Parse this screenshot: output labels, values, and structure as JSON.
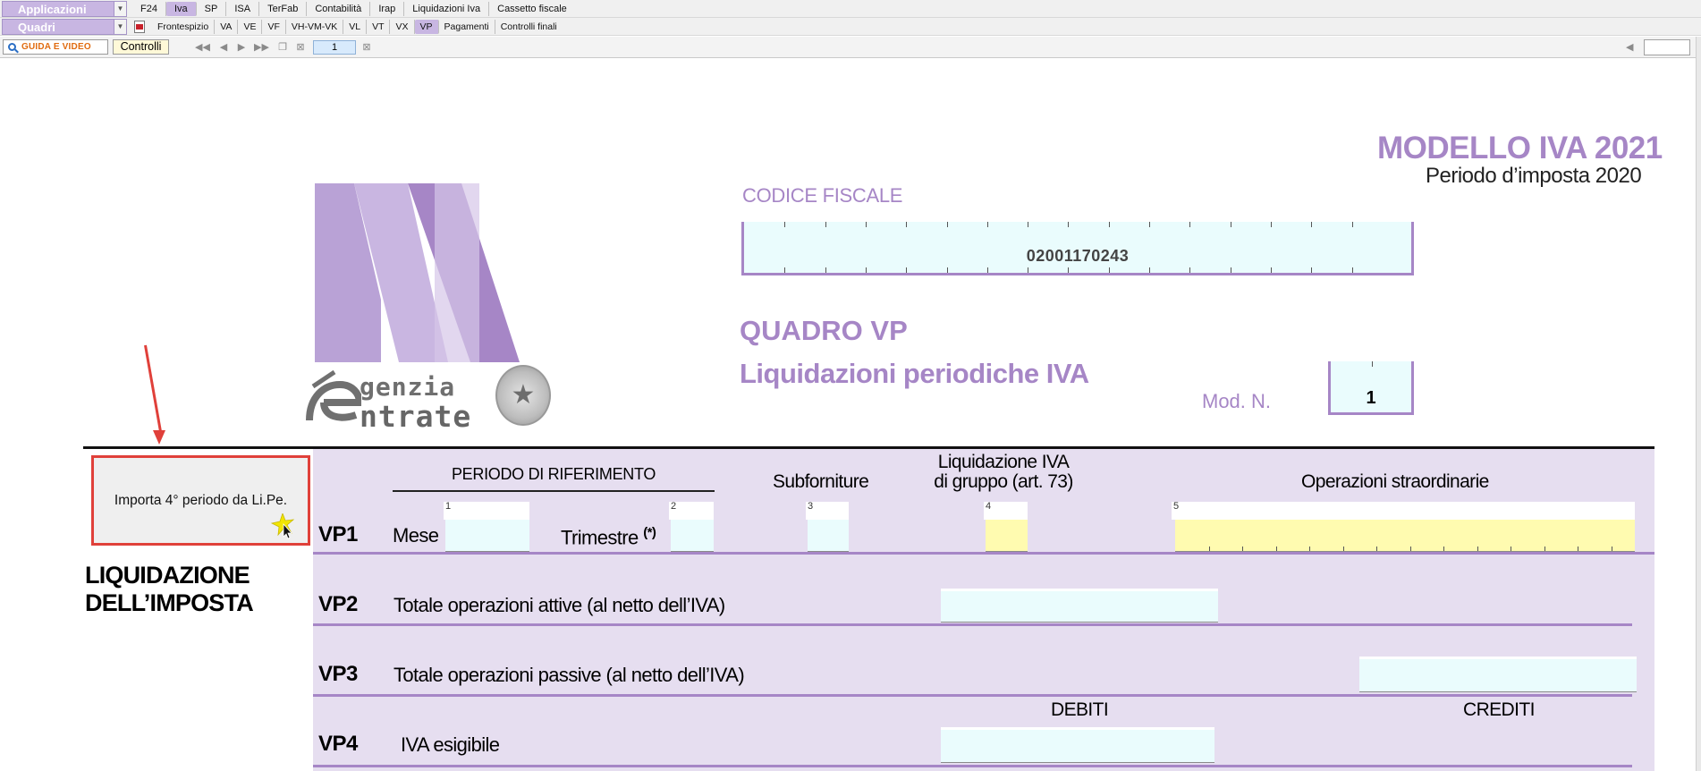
{
  "menu": {
    "apps_label": "Applicazioni",
    "apps_tabs": [
      {
        "label": "F24",
        "active": false
      },
      {
        "label": "Iva",
        "active": true
      },
      {
        "label": "SP",
        "active": false
      },
      {
        "label": "ISA",
        "active": false
      },
      {
        "label": "TerFab",
        "active": false
      },
      {
        "label": "Contabilità",
        "active": false
      },
      {
        "label": "Irap",
        "active": false
      },
      {
        "label": "Liquidazioni Iva",
        "active": false
      },
      {
        "label": "Cassetto fiscale",
        "active": false
      }
    ],
    "quadri_label": "Quadri",
    "quadri_tabs": [
      {
        "label": "Frontespizio",
        "active": false
      },
      {
        "label": "VA",
        "active": false
      },
      {
        "label": "VE",
        "active": false
      },
      {
        "label": "VF",
        "active": false
      },
      {
        "label": "VH-VM-VK",
        "active": false
      },
      {
        "label": "VL",
        "active": false
      },
      {
        "label": "VT",
        "active": false
      },
      {
        "label": "VX",
        "active": false
      },
      {
        "label": "VP",
        "active": true
      },
      {
        "label": "Pagamenti",
        "active": false
      },
      {
        "label": "Controlli finali",
        "active": false
      }
    ]
  },
  "toolbar": {
    "guida_label": "GUIDA E VIDEO",
    "controlli_label": "Controlli",
    "page_number": "1"
  },
  "header": {
    "modello": "MODELLO IVA 2021",
    "periodo": "Periodo d’imposta 2020",
    "cf_label": "CODICE FISCALE",
    "cf_value": "02001170243",
    "quadro": "QUADRO VP",
    "quadro_subtitle": "Liquidazioni periodiche IVA",
    "mod_n_label": "Mod. N.",
    "mod_n_value": "1"
  },
  "logo": {
    "agenzia": "genzia",
    "entrate": "ntrate"
  },
  "form": {
    "import_button": "Importa 4° periodo da Li.Pe.",
    "section_title_1": "LIQUIDAZIONE",
    "section_title_2": "DELL’IMPOSTA",
    "col_periodo": "PERIODO DI RIFERIMENTO",
    "col_subforniture": "Subforniture",
    "col_liq_gruppo_1": "Liquidazione IVA",
    "col_liq_gruppo_2": "di gruppo (art. 73)",
    "col_operazioni": "Operazioni straordinarie",
    "col_debiti": "DEBITI",
    "col_crediti": "CREDITI",
    "rows": {
      "vp1_code": "VP1",
      "vp1_mese": "Mese",
      "vp1_trimestre": "Trimestre",
      "vp1_star": "(*)",
      "vp2_code": "VP2",
      "vp2_label": "Totale operazioni attive (al netto dell’IVA)",
      "vp3_code": "VP3",
      "vp3_label": "Totale operazioni passive (al netto dell’IVA)",
      "vp4_code": "VP4",
      "vp4_label": "IVA esigibile"
    },
    "field_numbers": [
      "1",
      "2",
      "3",
      "4",
      "5"
    ]
  },
  "colors": {
    "brand_purple": "#a686c6",
    "field_cyan": "#eafcfd",
    "field_yellow": "#fffbb0",
    "highlight_red": "#e0403a"
  }
}
